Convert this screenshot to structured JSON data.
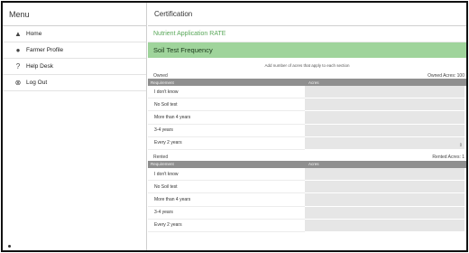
{
  "sidebar": {
    "title": "Menu",
    "items": [
      {
        "label": "Home",
        "icon": "home-icon"
      },
      {
        "label": "Farmer Profile",
        "icon": "person-icon"
      },
      {
        "label": "Help Desk",
        "icon": "question-icon"
      },
      {
        "label": "Log Out",
        "icon": "logout-icon"
      }
    ]
  },
  "main": {
    "title": "Certification",
    "link": "Nutrient Application RATE",
    "section_title": "Soil Test Frequency",
    "instruction": "Add number of acres that apply to each section",
    "owned": {
      "label": "Owned",
      "acres_label": "Owned Acres: 100",
      "col_requirement": "Requirement",
      "col_acres": "Acres",
      "rows": [
        "I don't know",
        "No Soil test",
        "More than 4 years",
        "3-4 years",
        "Every 2 years"
      ]
    },
    "rented": {
      "label": "Rented",
      "acres_label": "Rented Acres: 1",
      "col_requirement": "Requirement",
      "col_acres": "Acres",
      "rows": [
        "I don't know",
        "No Soil test",
        "More than 4 years",
        "3-4 years",
        "Every 2 years"
      ]
    }
  },
  "colors": {
    "accent_green": "#9fd49b",
    "link_green": "#5aa85a",
    "table_header": "#8f8f8f",
    "input_fill": "#e6e6e6"
  }
}
